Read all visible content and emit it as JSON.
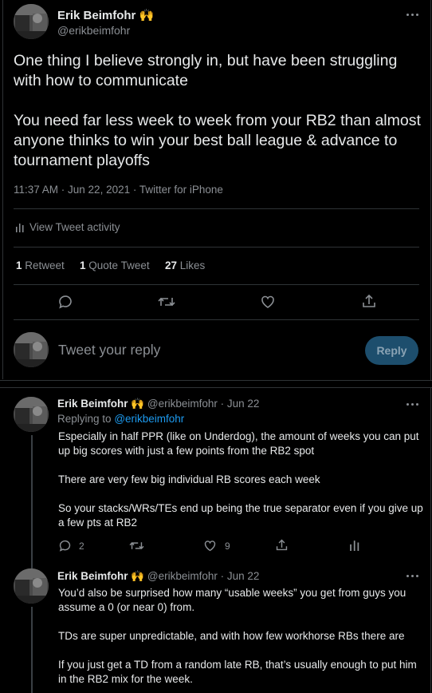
{
  "main_tweet": {
    "author_name": "Erik Beimfohr",
    "author_emoji": "🙌",
    "author_handle": "@erikbeimfohr",
    "paragraph_1": "One thing I believe strongly in, but have been struggling with how to communicate",
    "paragraph_2": "You need far less week to week from your RB2 than almost anyone thinks to win your best ball league & advance to tournament playoffs",
    "meta": "11:37 AM · Jun 22, 2021 · Twitter for iPhone",
    "activity_label": "View Tweet activity",
    "retweets_count": "1",
    "retweets_label": "Retweet",
    "quotes_count": "1",
    "quotes_label": "Quote Tweet",
    "likes_count": "27",
    "likes_label": "Likes"
  },
  "compose": {
    "placeholder": "Tweet your reply",
    "reply_button": "Reply"
  },
  "replies": [
    {
      "author_name": "Erik Beimfohr",
      "author_emoji": "🙌",
      "handle_date": "@erikbeimfohr · Jun 22",
      "replying_prefix": "Replying to",
      "replying_handle": "@erikbeimfohr",
      "paragraphs": [
        "Especially in half PPR (like on Underdog), the amount of weeks you can put up big scores with just a few points from the RB2 spot",
        "There are very few big individual RB scores each week",
        "So your stacks/WRs/TEs end up being the true separator even if you give up a few pts at RB2"
      ],
      "reply_count": "2",
      "like_count": "9"
    },
    {
      "author_name": "Erik Beimfohr",
      "author_emoji": "🙌",
      "handle_date": "@erikbeimfohr · Jun 22",
      "paragraphs": [
        "You’d also be surprised how many “usable weeks” you get from guys you assume a 0 (or near 0) from.",
        "TDs are super unpredictable, and with how few workhorse RBs there are",
        "If you just get a TD from a random late RB, that’s usually enough to put him in the RB2 mix for the week."
      ]
    }
  ],
  "colors": {
    "background": "#000000",
    "text": "#e7e9ea",
    "muted": "#8b8f94",
    "accent": "#1d9bf0",
    "reply_button_bg": "#1d4e6d"
  },
  "icons": [
    "more-icon",
    "reply-icon",
    "retweet-icon",
    "like-icon",
    "share-icon",
    "analytics-icon"
  ]
}
